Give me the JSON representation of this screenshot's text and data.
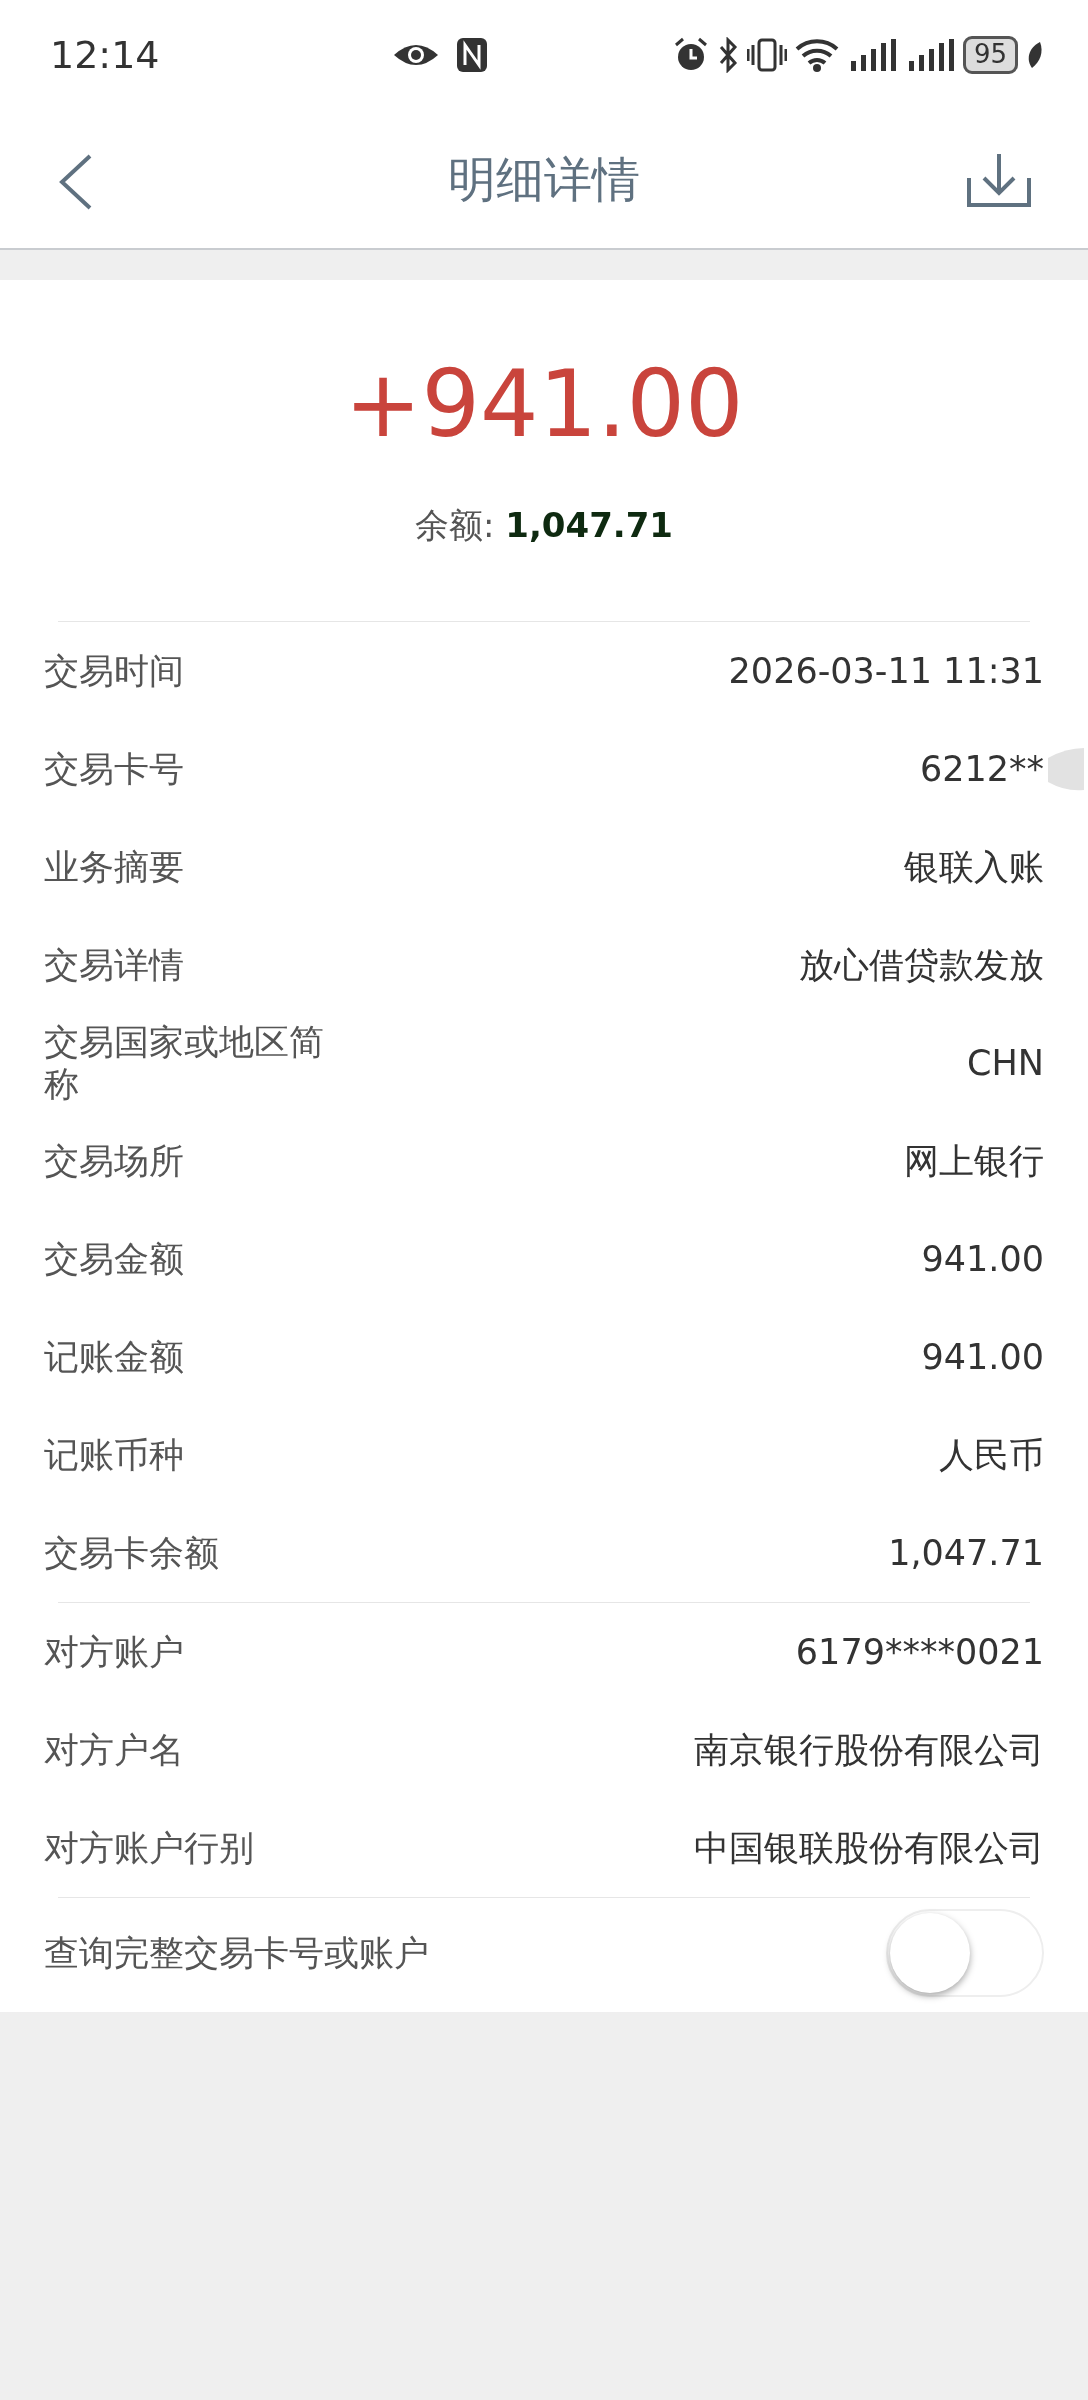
{
  "status_bar": {
    "time": "12:14",
    "battery": "95"
  },
  "header": {
    "title": "明细详情"
  },
  "summary": {
    "amount": "+941.00",
    "balance_label": "余额:",
    "balance_value": "1,047.71"
  },
  "sections": [
    [
      {
        "label": "交易时间",
        "value": "2026-03-11 11:31"
      },
      {
        "label": "交易卡号",
        "value": "6212**",
        "redacted": true
      },
      {
        "label": "业务摘要",
        "value": "银联入账"
      },
      {
        "label": "交易详情",
        "value": "放心借贷款发放"
      },
      {
        "label": "交易国家或地区简称",
        "value": "CHN"
      },
      {
        "label": "交易场所",
        "value": "网上银行"
      },
      {
        "label": "交易金额",
        "value": "941.00"
      },
      {
        "label": "记账金额",
        "value": "941.00"
      },
      {
        "label": "记账币种",
        "value": "人民币"
      },
      {
        "label": "交易卡余额",
        "value": "1,047.71"
      }
    ],
    [
      {
        "label": "对方账户",
        "value": "6179****0021"
      },
      {
        "label": "对方户名",
        "value": "南京银行股份有限公司"
      },
      {
        "label": "对方账户行别",
        "value": "中国银联股份有限公司"
      }
    ]
  ],
  "toggle": {
    "label": "查询完整交易卡号或账户",
    "on": false
  }
}
